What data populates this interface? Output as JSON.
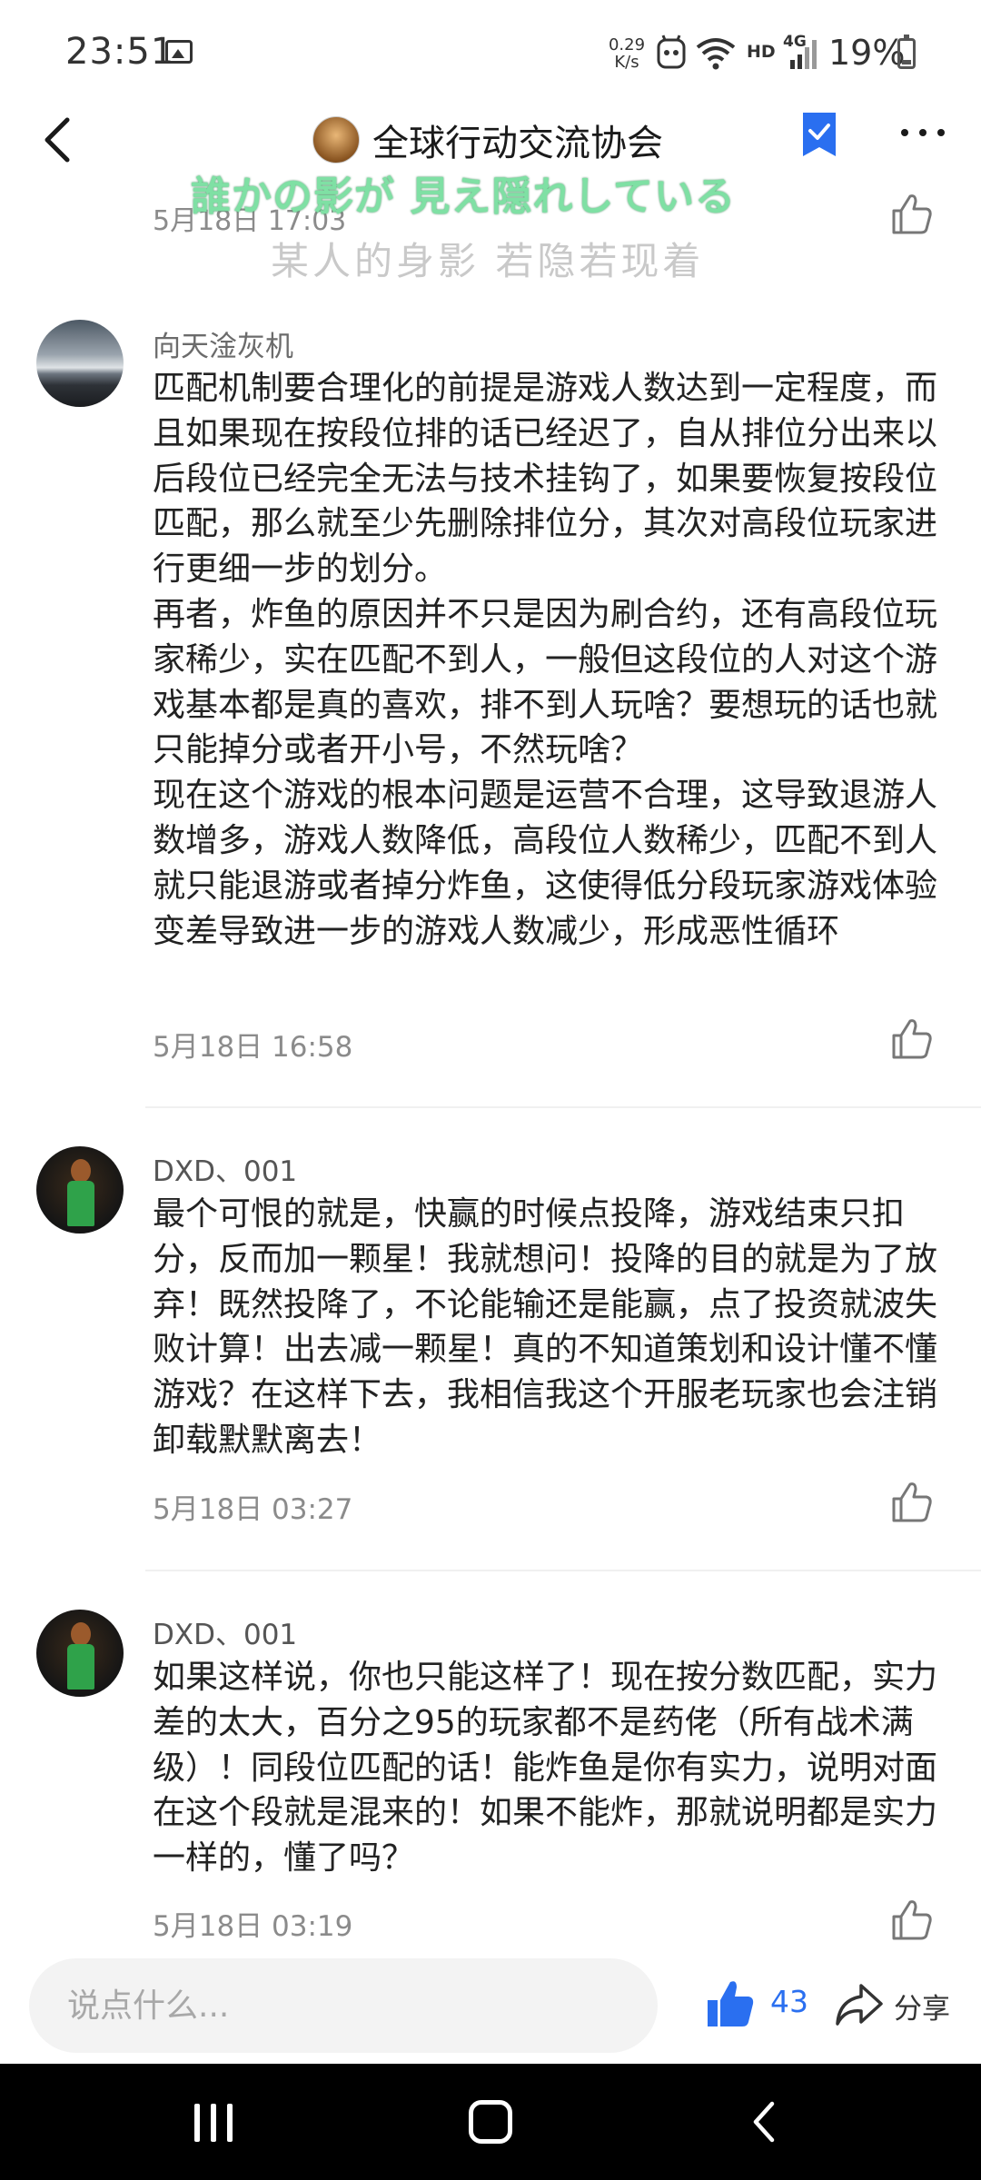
{
  "status_bar": {
    "time": "23:51",
    "net_speed_value": "0.29",
    "net_speed_unit": "K/s",
    "hd_label": "HD",
    "network_label": "4G",
    "battery_percent": "19%",
    "battery_level": 0.19
  },
  "header": {
    "title": "全球行动交流协会",
    "accent_color": "#2a6ff0"
  },
  "lyrics": {
    "japanese": "誰かの影が 見え隠れしている",
    "chinese": "某人的身影 若隐若现着"
  },
  "partial_comment": {
    "date": "5月18日 17:03"
  },
  "comments": [
    {
      "username": "向天淦灰机",
      "body": "匹配机制要合理化的前提是游戏人数达到一定程度，而且如果现在按段位排的话已经迟了，自从排位分出来以后段位已经完全无法与技术挂钩了，如果要恢复按段位匹配，那么就至少先删除排位分，其次对高段位玩家进行更细一步的划分。\n再者，炸鱼的原因并不只是因为刷合约，还有高段位玩家稀少，实在匹配不到人，一般但这段位的人对这个游戏基本都是真的喜欢，排不到人玩啥？要想玩的话也就只能掉分或者开小号，不然玩啥？\n现在这个游戏的根本问题是运营不合理，这导致退游人数增多，游戏人数降低，高段位人数稀少，匹配不到人就只能退游或者掉分炸鱼，这使得低分段玩家游戏体验变差导致进一步的游戏人数减少，形成恶性循环",
      "date": "5月18日 16:58"
    },
    {
      "username": "DXD、001",
      "body": "最个可恨的就是，快赢的时候点投降，游戏结束只扣分，反而加一颗星！我就想问！投降的目的就是为了放弃！既然投降了，不论能输还是能赢，点了投资就波失败计算！出去减一颗星！真的不知道策划和设计懂不懂游戏？在这样下去，我相信我这个开服老玩家也会注销卸载默默离去！",
      "date": "5月18日 03:27"
    },
    {
      "username": "DXD、001",
      "body": "如果这样说，你也只能这样了！现在按分数匹配，实力差的太大，百分之95的玩家都不是药佬（所有战术满级）！同段位匹配的话！能炸鱼是你有实力，说明对面在这个段就是混来的！如果不能炸，那就说明都是实力一样的，懂了吗？",
      "date": "5月18日 03:19"
    }
  ],
  "bottom_bar": {
    "input_placeholder": "说点什么...",
    "like_count": "43",
    "share_label": "分享"
  }
}
